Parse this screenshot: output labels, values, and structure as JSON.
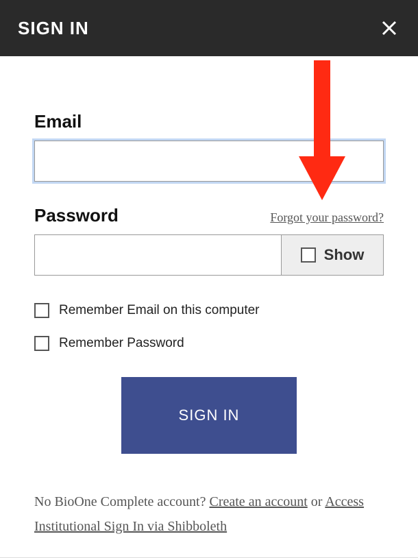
{
  "header": {
    "title": "SIGN IN"
  },
  "form": {
    "email_label": "Email",
    "email_value": "",
    "password_label": "Password",
    "forgot_link": "Forgot your password?",
    "show_label": "Show",
    "remember_email": "Remember Email on this computer",
    "remember_password": "Remember Password",
    "signin_button": "SIGN IN"
  },
  "footer": {
    "no_account_prefix": "No BioOne Complete account? ",
    "create_account": "Create an account",
    "or_text": " or ",
    "shibboleth": "Access Institutional Sign In via Shibboleth"
  }
}
